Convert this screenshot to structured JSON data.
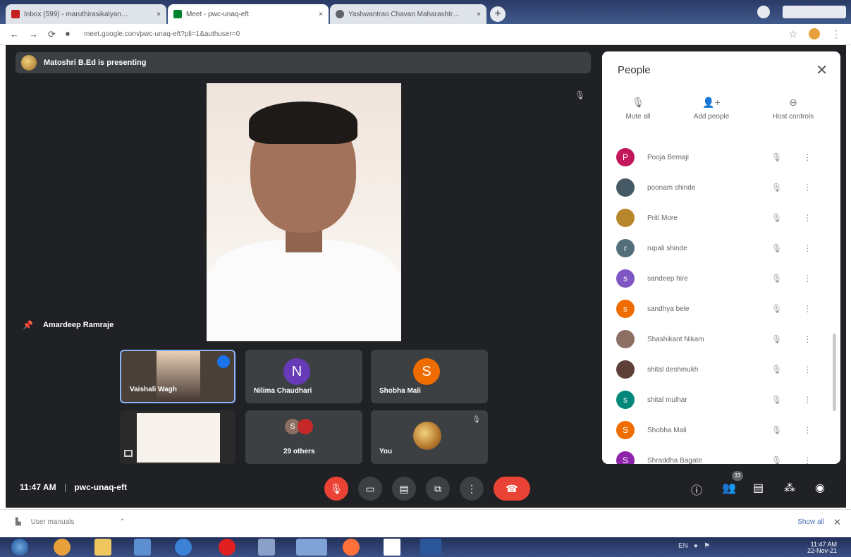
{
  "browser": {
    "tabs": [
      {
        "label": "Inbox (599) - maruthirasikalyan…",
        "close": "×",
        "color": "#c5221f"
      },
      {
        "label": "Meet - pwc-unaq-eft",
        "close": "×",
        "color": "#00832d"
      },
      {
        "label": "Yashwantrao Chavan Maharashtr…",
        "close": "×",
        "color": "#5f6368"
      }
    ],
    "new_tab": "+",
    "nav_back": "←",
    "nav_forward": "→",
    "reload": "⟳",
    "url": "meet.google.com/pwc-unaq-eft?pli=1&authuser=0",
    "star": "☆",
    "menu": "⋮"
  },
  "meet": {
    "presenting_text": "Matoshri B.Ed is presenting",
    "pinned_name": "Amardeep Ramraje",
    "tiles": [
      {
        "name": "Vaishali Wagh",
        "active": true
      },
      {
        "name": "Nilima Chaudhari",
        "initial": "N",
        "color": "#673ab7"
      },
      {
        "name": "Shobha Mali",
        "initial": "S",
        "color": "#ef6c00"
      },
      {
        "name": "",
        "kind": "presentation"
      },
      {
        "name": "29 others",
        "initial": "S",
        "color": "#8d6e63"
      },
      {
        "name": "You"
      }
    ],
    "time": "11:47 AM",
    "separator": "|",
    "meeting_code": "pwc-unaq-eft",
    "people_badge": "33"
  },
  "people_panel": {
    "title": "People",
    "close": "✕",
    "actions": [
      {
        "label": "Mute all",
        "icon": "mute-all-icon"
      },
      {
        "label": "Add people",
        "icon": "add-person-icon"
      },
      {
        "label": "Host controls",
        "icon": "host-controls-icon"
      }
    ],
    "participants": [
      {
        "name": "Pooja Bemaji",
        "initial": "P",
        "color": "#c2185b"
      },
      {
        "name": "poonam shinde",
        "initial": "",
        "color": "#455a64",
        "photo": true
      },
      {
        "name": "Priti More",
        "initial": "",
        "color": "#b8862b",
        "photo": true
      },
      {
        "name": "rupali shinde",
        "initial": "r",
        "color": "#546e7a"
      },
      {
        "name": "sandeep hire",
        "initial": "s",
        "color": "#7e57c2"
      },
      {
        "name": "sandhya bele",
        "initial": "s",
        "color": "#ef6c00"
      },
      {
        "name": "Shashikant Nikam",
        "initial": "",
        "color": "#8d6e63",
        "photo": true
      },
      {
        "name": "shital deshmukh",
        "initial": "",
        "color": "#5d4037",
        "photo": true
      },
      {
        "name": "shital mulhar",
        "initial": "s",
        "color": "#00897b"
      },
      {
        "name": "Shobha Mali",
        "initial": "S",
        "color": "#ef6c00"
      },
      {
        "name": "Shraddha Bagate",
        "initial": "S",
        "color": "#8e24aa"
      }
    ]
  },
  "download_shelf": {
    "file": "User manuals",
    "show_all": "Show all",
    "close": "✕"
  },
  "taskbar": {
    "time": "11:47 AM",
    "date": "22-Nov-21",
    "lang": "EN"
  }
}
